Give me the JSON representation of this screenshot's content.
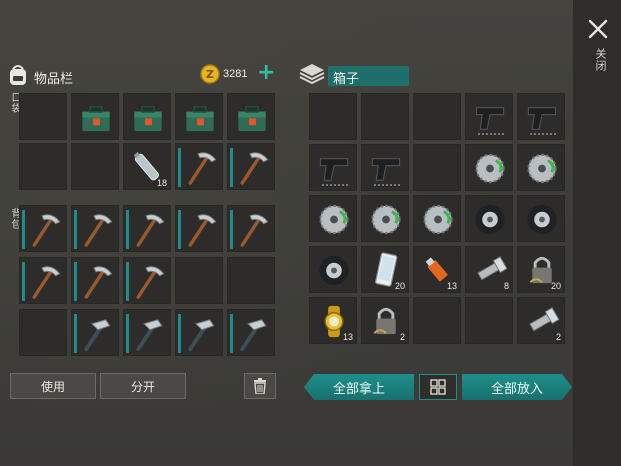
{
  "inventory": {
    "title": "物品栏",
    "currency_icon": "coin-icon",
    "coins": "3281",
    "add_label": "+",
    "pocket_label": "口袋",
    "backpack_label": "背包",
    "use_label": "使用",
    "split_label": "分开",
    "trash_icon": "trash-icon",
    "pocket_slots": [
      {
        "item": "",
        "count": ""
      },
      {
        "item": "toolbox",
        "count": ""
      },
      {
        "item": "toolbox",
        "count": ""
      },
      {
        "item": "toolbox",
        "count": ""
      },
      {
        "item": "toolbox",
        "count": ""
      },
      {
        "item": "",
        "count": ""
      },
      {
        "item": "",
        "count": ""
      },
      {
        "item": "water-bottle",
        "count": "18"
      },
      {
        "item": "pickaxe",
        "count": ""
      },
      {
        "item": "pickaxe",
        "count": ""
      }
    ],
    "backpack_slots": [
      {
        "item": "pickaxe",
        "count": ""
      },
      {
        "item": "pickaxe",
        "count": ""
      },
      {
        "item": "pickaxe",
        "count": ""
      },
      {
        "item": "pickaxe",
        "count": ""
      },
      {
        "item": "pickaxe",
        "count": ""
      },
      {
        "item": "pickaxe",
        "count": ""
      },
      {
        "item": "pickaxe",
        "count": ""
      },
      {
        "item": "pickaxe",
        "count": ""
      },
      {
        "item": "",
        "count": ""
      },
      {
        "item": "",
        "count": ""
      },
      {
        "item": "",
        "count": ""
      },
      {
        "item": "hammer",
        "count": ""
      },
      {
        "item": "hammer",
        "count": ""
      },
      {
        "item": "hammer",
        "count": ""
      },
      {
        "item": "hammer",
        "count": ""
      }
    ]
  },
  "box": {
    "title": "箱子",
    "take_all_label": "全部拿上",
    "put_all_label": "全部放入",
    "sort_icon": "grid-sort-icon",
    "slots": [
      {
        "item": "",
        "count": ""
      },
      {
        "item": "",
        "count": ""
      },
      {
        "item": "",
        "count": ""
      },
      {
        "item": "pistol",
        "count": ""
      },
      {
        "item": "pistol",
        "count": ""
      },
      {
        "item": "pistol",
        "count": ""
      },
      {
        "item": "pistol",
        "count": ""
      },
      {
        "item": "",
        "count": ""
      },
      {
        "item": "saw-blade",
        "count": ""
      },
      {
        "item": "saw-blade",
        "count": ""
      },
      {
        "item": "saw-blade",
        "count": ""
      },
      {
        "item": "saw-blade",
        "count": ""
      },
      {
        "item": "saw-blade",
        "count": ""
      },
      {
        "item": "tire",
        "count": ""
      },
      {
        "item": "tire",
        "count": ""
      },
      {
        "item": "tire",
        "count": ""
      },
      {
        "item": "smartphone",
        "count": "20"
      },
      {
        "item": "usb-drive",
        "count": "13"
      },
      {
        "item": "flashlight",
        "count": "8"
      },
      {
        "item": "padlock",
        "count": "20"
      },
      {
        "item": "gold-watch",
        "count": "13"
      },
      {
        "item": "padlock",
        "count": "2"
      },
      {
        "item": "",
        "count": ""
      },
      {
        "item": "",
        "count": ""
      },
      {
        "item": "flashlight",
        "count": "2"
      }
    ]
  },
  "close": {
    "icon": "close-icon",
    "label": "关闭"
  },
  "colors": {
    "accent": "#1f8f8c",
    "coin": "#e6b422",
    "plus": "#2fc29a"
  }
}
